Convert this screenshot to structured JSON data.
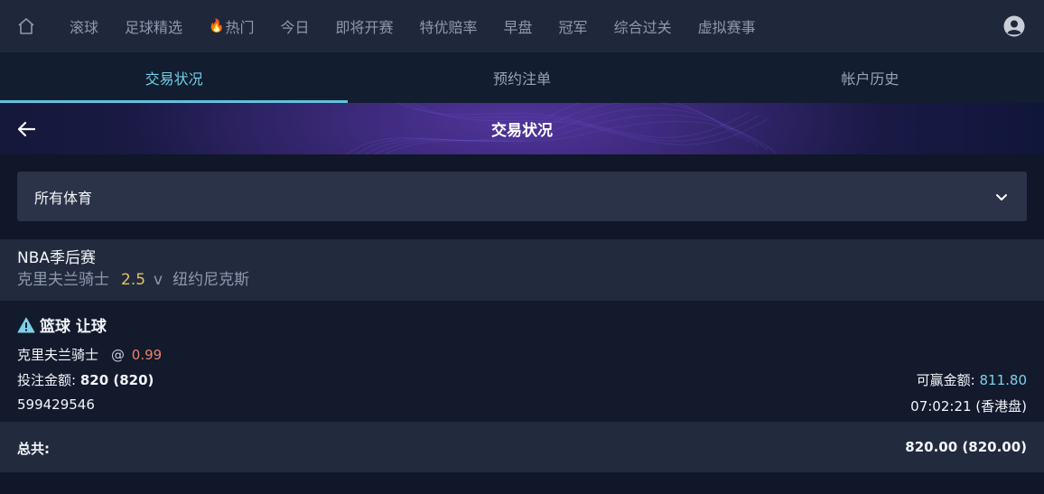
{
  "nav": {
    "items": [
      "滚球",
      "足球精选",
      "热门",
      "今日",
      "即将开赛",
      "特优赔率",
      "早盘",
      "冠军",
      "综合过关",
      "虚拟赛事"
    ],
    "hot_icon": "flame-icon"
  },
  "tabs": [
    "交易状况",
    "预约注单",
    "帐户历史"
  ],
  "page_title": "交易状况",
  "filter": {
    "selected": "所有体育"
  },
  "match": {
    "league": "NBA季后赛",
    "home": "克里夫兰骑士",
    "line": "2.5",
    "vs": "v",
    "away": "纽约尼克斯"
  },
  "bet": {
    "type": "篮球 让球",
    "selection": "克里夫兰骑士",
    "at": "@",
    "odds": "0.99",
    "stake_label": "投注金额:",
    "stake_value": "820 (820)",
    "win_label": "可赢金额:",
    "win_value": "811.80",
    "id": "599429546",
    "time": "07:02:21 (香港盘)"
  },
  "total": {
    "label": "总共:",
    "value": "820.00 (820.00)"
  },
  "colors": {
    "accent": "#5fc3dd",
    "odds": "#e8826b",
    "line": "#e8c062",
    "win": "#7fd0e6"
  }
}
